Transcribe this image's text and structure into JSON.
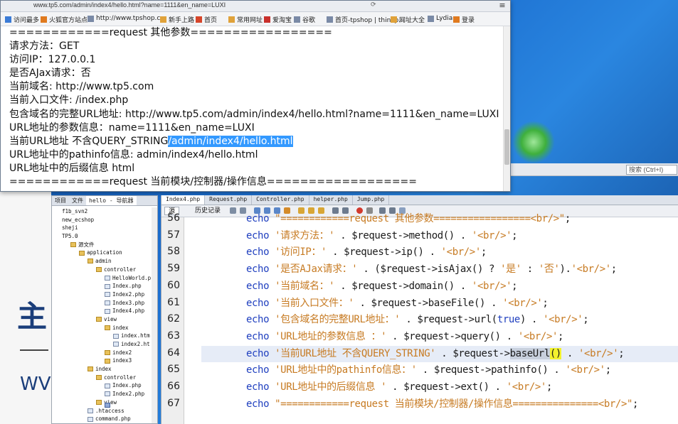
{
  "browser": {
    "url": "www.tp5.com/admin/index4/hello.html?name=1111&en_name=LUXI",
    "bookmarks": [
      "访问最多",
      "火狐官方站点",
      "http://www.tpshop.c...",
      "新手上路",
      "首页",
      "常用网址",
      "爱淘宝",
      "谷歌",
      "首页-tpshop | thinkp...",
      "网址大全",
      "Lydia",
      "登录"
    ],
    "lines": [
      "============request 其他参数=================",
      "请求方法：GET",
      "访问IP：127.0.0.1",
      "是否AJax请求：否",
      "当前域名: http://www.tp5.com",
      "当前入口文件: /index.php",
      "包含域名的完整URL地址: http://www.tp5.com/admin/index4/hello.html?name=1111&en_name=LUXI",
      "URL地址的参数信息：name=1111&en_name=LUXI",
      "URL地址中的pathinfo信息: admin/index4/hello.html",
      "URL地址中的后缀信息 html",
      "============request 当前模块/控制器/操作信息=================="
    ],
    "current_line_prefix": "当前URL地址 不含QUERY_STRING",
    "current_line_selected": "/admin/index4/hello.html"
  },
  "desktop": {
    "big_char": "主",
    "big_ww": "WV"
  },
  "ide": {
    "search_placeholder": "搜索 (Ctrl+I)",
    "project_tabs": [
      "项目",
      "文件",
      "hello - 导航器"
    ],
    "tree": [
      {
        "label": "f1b_svn2",
        "depth": 1,
        "kind": "proj"
      },
      {
        "label": "new_ecshop",
        "depth": 1,
        "kind": "proj"
      },
      {
        "label": "sheji",
        "depth": 1,
        "kind": "proj"
      },
      {
        "label": "TP5.0",
        "depth": 1,
        "kind": "proj"
      },
      {
        "label": "源文件",
        "depth": 2,
        "kind": "folder"
      },
      {
        "label": "application",
        "depth": 3,
        "kind": "folder"
      },
      {
        "label": "admin",
        "depth": 4,
        "kind": "folder"
      },
      {
        "label": "controller",
        "depth": 5,
        "kind": "folder"
      },
      {
        "label": "HelloWorld.p",
        "depth": 6,
        "kind": "file"
      },
      {
        "label": "Index.php",
        "depth": 6,
        "kind": "file"
      },
      {
        "label": "Index2.php",
        "depth": 6,
        "kind": "file"
      },
      {
        "label": "Index3.php",
        "depth": 6,
        "kind": "file"
      },
      {
        "label": "Index4.php",
        "depth": 6,
        "kind": "file"
      },
      {
        "label": "view",
        "depth": 5,
        "kind": "folder"
      },
      {
        "label": "index",
        "depth": 6,
        "kind": "folder"
      },
      {
        "label": "index.htm",
        "depth": 7,
        "kind": "file"
      },
      {
        "label": "index2.ht",
        "depth": 7,
        "kind": "file"
      },
      {
        "label": "index2",
        "depth": 6,
        "kind": "folder"
      },
      {
        "label": "index3",
        "depth": 6,
        "kind": "folder"
      },
      {
        "label": "index",
        "depth": 4,
        "kind": "folder"
      },
      {
        "label": "controller",
        "depth": 5,
        "kind": "folder"
      },
      {
        "label": "Index.php",
        "depth": 6,
        "kind": "file"
      },
      {
        "label": "Index2.php",
        "depth": 6,
        "kind": "file"
      },
      {
        "label": "view",
        "depth": 5,
        "kind": "folder"
      },
      {
        "label": ".htaccess",
        "depth": 4,
        "kind": "file"
      },
      {
        "label": "command.php",
        "depth": 4,
        "kind": "file"
      }
    ],
    "editor_tabs": [
      "Index4.php",
      "Request.php",
      "Controller.php",
      "helper.php",
      "Jump.php"
    ],
    "toolbar": {
      "source": "源",
      "history": "历史记录"
    },
    "code": [
      {
        "num": "56",
        "parts": [
          [
            "kw",
            "echo "
          ],
          [
            "str",
            "\"============request 其他参数=================<br/>\""
          ],
          [
            "var",
            ";"
          ]
        ]
      },
      {
        "num": "57",
        "parts": [
          [
            "kw",
            "echo "
          ],
          [
            "str",
            "'请求方法：'"
          ],
          [
            "var",
            " . $request->method() . "
          ],
          [
            "str",
            "'<br/>'"
          ],
          [
            "var",
            ";"
          ]
        ]
      },
      {
        "num": "58",
        "parts": [
          [
            "kw",
            "echo "
          ],
          [
            "str",
            "'访问IP：'"
          ],
          [
            "var",
            " . $request->ip() . "
          ],
          [
            "str",
            "'<br/>'"
          ],
          [
            "var",
            ";"
          ]
        ]
      },
      {
        "num": "59",
        "parts": [
          [
            "kw",
            "echo "
          ],
          [
            "str",
            "'是否AJax请求：'"
          ],
          [
            "var",
            " . ($request->isAjax() ? "
          ],
          [
            "str",
            "'是'"
          ],
          [
            "var",
            " : "
          ],
          [
            "str",
            "'否'"
          ],
          [
            "var",
            ")."
          ],
          [
            "str",
            "'<br/>'"
          ],
          [
            "var",
            ";"
          ]
        ]
      },
      {
        "num": "60",
        "parts": [
          [
            "kw",
            "echo "
          ],
          [
            "str",
            "'当前域名：'"
          ],
          [
            "var",
            " . $request->domain() . "
          ],
          [
            "str",
            "'<br/>'"
          ],
          [
            "var",
            ";"
          ]
        ]
      },
      {
        "num": "61",
        "parts": [
          [
            "kw",
            "echo "
          ],
          [
            "str",
            "'当前入口文件：'"
          ],
          [
            "var",
            " . $request->baseFile() . "
          ],
          [
            "str",
            "'<br/>'"
          ],
          [
            "var",
            ";"
          ]
        ]
      },
      {
        "num": "62",
        "parts": [
          [
            "kw",
            "echo "
          ],
          [
            "str",
            "'包含域名的完整URL地址：'"
          ],
          [
            "var",
            " . $request->url("
          ],
          [
            "kw",
            "true"
          ],
          [
            "var",
            ") . "
          ],
          [
            "str",
            "'<br/>'"
          ],
          [
            "var",
            ";"
          ]
        ]
      },
      {
        "num": "63",
        "parts": [
          [
            "kw",
            "echo "
          ],
          [
            "str",
            "'URL地址的参数信息 ：'"
          ],
          [
            "var",
            " . $request->query() . "
          ],
          [
            "str",
            "'<br/>'"
          ],
          [
            "var",
            ";"
          ]
        ]
      },
      {
        "num": "64",
        "parts": [
          [
            "kw",
            "echo "
          ],
          [
            "str",
            "'当前URL地址 不含QUERY_STRING'"
          ],
          [
            "var",
            " . $request->"
          ],
          [
            "sel",
            "baseUrl"
          ],
          [
            "paren",
            "()"
          ],
          [
            "var",
            " . "
          ],
          [
            "str",
            "'<br/>'"
          ],
          [
            "var",
            ";"
          ]
        ],
        "current": true
      },
      {
        "num": "65",
        "parts": [
          [
            "kw",
            "echo "
          ],
          [
            "str",
            "'URL地址中的pathinfo信息：'"
          ],
          [
            "var",
            " . $request->pathinfo() . "
          ],
          [
            "str",
            "'<br/>'"
          ],
          [
            "var",
            ";"
          ]
        ]
      },
      {
        "num": "66",
        "parts": [
          [
            "kw",
            "echo "
          ],
          [
            "str",
            "'URL地址中的后缀信息 '"
          ],
          [
            "var",
            " . $request->ext() . "
          ],
          [
            "str",
            "'<br/>'"
          ],
          [
            "var",
            ";"
          ]
        ]
      },
      {
        "num": "67",
        "parts": [
          [
            "kw",
            "echo "
          ],
          [
            "str",
            "\"============request 当前模块/控制器/操作信息===============<br/>\""
          ],
          [
            "var",
            ";"
          ]
        ]
      }
    ]
  }
}
